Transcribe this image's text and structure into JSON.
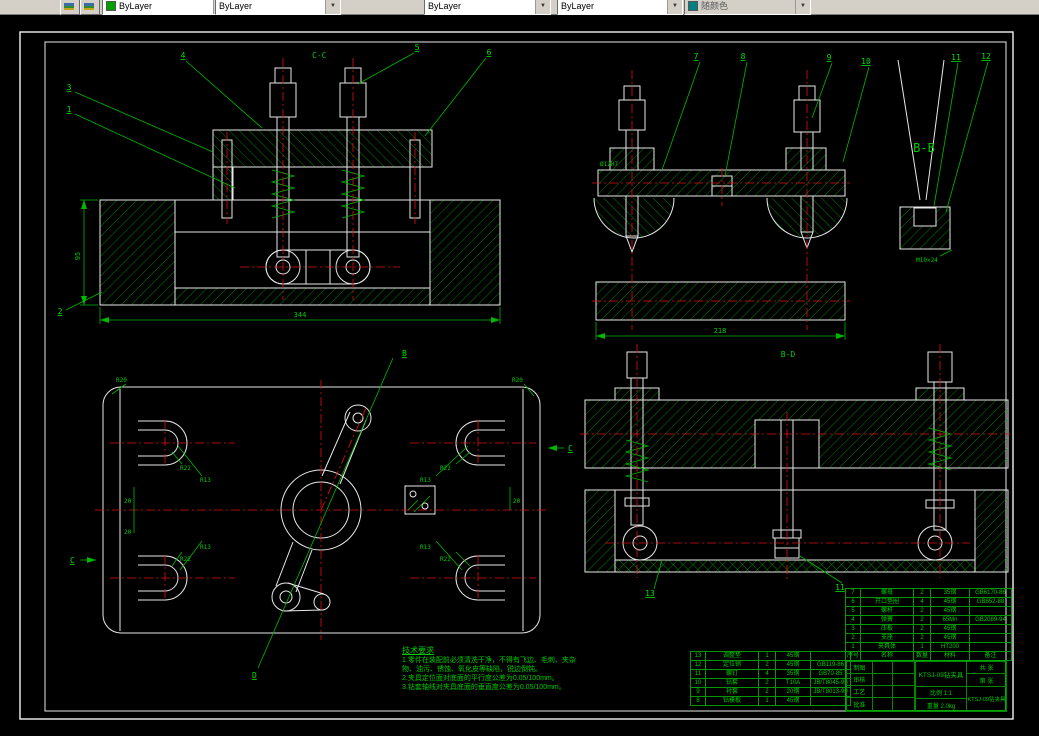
{
  "toolbar": {
    "color_value": "ByLayer",
    "linetype_value": "ByLayer",
    "lineweight_value": "ByLayer",
    "plotstyle_value": "随颜色",
    "swatch_style": "background:#00a000",
    "plot_swatch_style": "background:#008080"
  },
  "view_labels": {
    "cc": "C-C",
    "bb": "B-B",
    "bd": "B-D"
  },
  "balloons": {
    "b1": "1",
    "b2": "2",
    "b3": "3",
    "b4": "4",
    "b5": "5",
    "b6": "6",
    "b7": "7",
    "b8": "8",
    "b9": "9",
    "b10": "10",
    "b11": "11",
    "b12": "12",
    "b13": "13"
  },
  "dims": {
    "len344": "344",
    "h95": "95",
    "w218": "218",
    "r20": "R20",
    "r22": "R22",
    "r13": "R13",
    "d20": "20",
    "dia12": "Ø12H7",
    "m10": "M10×24"
  },
  "sections": {
    "b": "B",
    "c": "C",
    "d": "D"
  },
  "notes": {
    "title": "技术要求",
    "line1": "1.零件在装配前必须清洗干净，不得有飞边、毛刺、夹杂",
    "line2": "物、油污、锈蚀、氧化皮等缺陷，锐边倒钝。",
    "line3": "2.夹具定位面对底面的平行度公差为0.05/100mm。",
    "line4": "3.钻套轴线对夹具底面的垂直度公差为0.05/100mm。"
  },
  "bom_header": {
    "no": "序号",
    "name": "名称",
    "qty": "数量",
    "mat": "材料",
    "code": "备注"
  },
  "bom_left": {
    "rows": [
      {
        "no": "13",
        "name": "调整垫",
        "qty": "1",
        "mat": "45钢",
        "code": ""
      },
      {
        "no": "12",
        "name": "定位销",
        "qty": "2",
        "mat": "45钢",
        "code": "GB119-86"
      },
      {
        "no": "11",
        "name": "螺钉",
        "qty": "4",
        "mat": "35钢",
        "code": "GB70-85"
      },
      {
        "no": "10",
        "name": "钻套",
        "qty": "2",
        "mat": "T10A",
        "code": "JB/T8045-95"
      },
      {
        "no": "9",
        "name": "衬套",
        "qty": "2",
        "mat": "20钢",
        "code": "JB/T8013-99"
      },
      {
        "no": "8",
        "name": "钻模板",
        "qty": "1",
        "mat": "45钢",
        "code": ""
      }
    ]
  },
  "bom_right": {
    "rows": [
      {
        "no": "7",
        "name": "螺母",
        "qty": "2",
        "mat": "35钢",
        "code": "GB6170-86"
      },
      {
        "no": "6",
        "name": "开口垫圈",
        "qty": "4",
        "mat": "45钢",
        "code": "GB852-88"
      },
      {
        "no": "5",
        "name": "螺杆",
        "qty": "2",
        "mat": "45钢",
        "code": ""
      },
      {
        "no": "4",
        "name": "弹簧",
        "qty": "2",
        "mat": "65Mn",
        "code": "GB2089-94"
      },
      {
        "no": "3",
        "name": "压板",
        "qty": "2",
        "mat": "45钢",
        "code": ""
      },
      {
        "no": "2",
        "name": "支座",
        "qty": "2",
        "mat": "45钢",
        "code": ""
      },
      {
        "no": "1",
        "name": "夹具体",
        "qty": "1",
        "mat": "HT200",
        "code": ""
      }
    ]
  },
  "titleblock": {
    "row1": "制图",
    "row2": "审核",
    "row3": "工艺",
    "row4": "批准",
    "title": "KTSJ-09钻夹具",
    "scale": "比例 1:1",
    "weight": "重量 2.0kg",
    "sheets": "共 张",
    "sheet": "第 张",
    "drawing_no": "KTSJ-09钻夹具"
  }
}
